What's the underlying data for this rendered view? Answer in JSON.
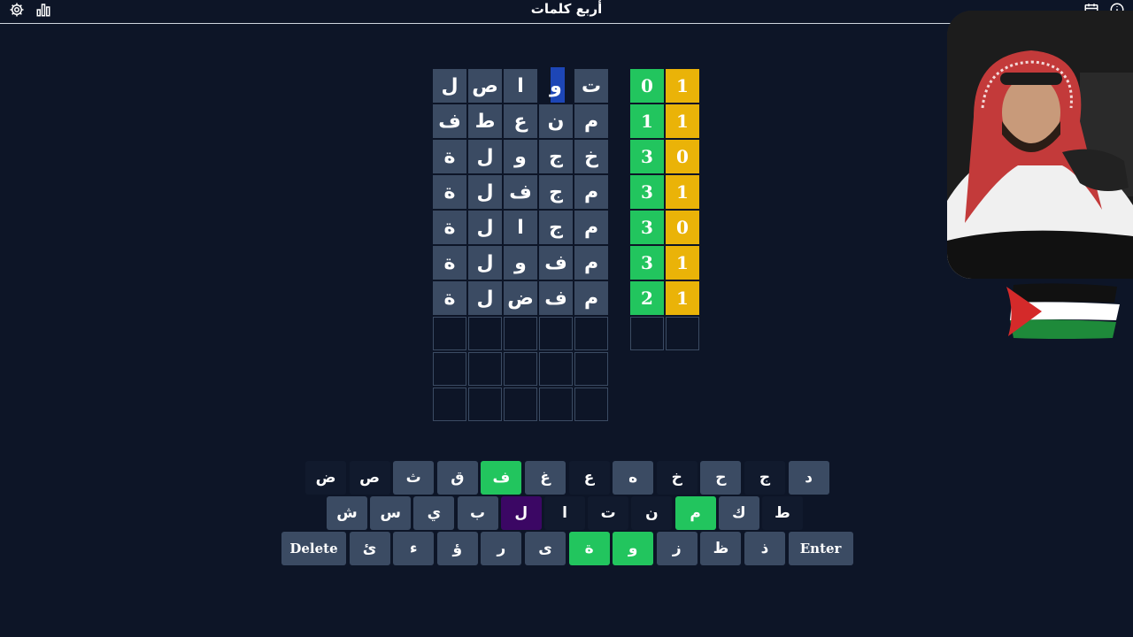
{
  "header": {
    "title": "أربع كلمات"
  },
  "icons": {
    "settings": "gear-icon",
    "stats": "bar-chart-icon",
    "calendar": "calendar-icon",
    "info": "info-icon"
  },
  "board": {
    "rows": [
      [
        "ل",
        "ص",
        "ا",
        "و",
        "ت"
      ],
      [
        "ف",
        "ط",
        "ع",
        "ن",
        "م"
      ],
      [
        "ة",
        "ل",
        "و",
        "ج",
        "خ"
      ],
      [
        "ة",
        "ل",
        "ف",
        "ج",
        "م"
      ],
      [
        "ة",
        "ل",
        "ا",
        "ج",
        "م"
      ],
      [
        "ة",
        "ل",
        "و",
        "ف",
        "م"
      ],
      [
        "ة",
        "ل",
        "ض",
        "ف",
        "م"
      ]
    ],
    "empty_rows": 3,
    "scores": [
      {
        "green": "0",
        "yellow": "1"
      },
      {
        "green": "1",
        "yellow": "1"
      },
      {
        "green": "3",
        "yellow": "0"
      },
      {
        "green": "3",
        "yellow": "1"
      },
      {
        "green": "3",
        "yellow": "0"
      },
      {
        "green": "3",
        "yellow": "1"
      },
      {
        "green": "2",
        "yellow": "1"
      }
    ],
    "colors": {
      "tile": "#3b4b63",
      "green": "#22c55e",
      "yellow": "#eab308",
      "cursor": "#1d46b6"
    }
  },
  "keyboard": {
    "row1": [
      {
        "label": "ض",
        "state": "dark"
      },
      {
        "label": "ص",
        "state": "dark"
      },
      {
        "label": "ث",
        "state": "normal"
      },
      {
        "label": "ق",
        "state": "normal"
      },
      {
        "label": "ف",
        "state": "green"
      },
      {
        "label": "غ",
        "state": "normal"
      },
      {
        "label": "ع",
        "state": "dark"
      },
      {
        "label": "ه",
        "state": "normal"
      },
      {
        "label": "خ",
        "state": "dark"
      },
      {
        "label": "ح",
        "state": "normal"
      },
      {
        "label": "ج",
        "state": "dark"
      },
      {
        "label": "د",
        "state": "normal"
      }
    ],
    "row2": [
      {
        "label": "ش",
        "state": "normal"
      },
      {
        "label": "س",
        "state": "normal"
      },
      {
        "label": "ي",
        "state": "normal"
      },
      {
        "label": "ب",
        "state": "normal"
      },
      {
        "label": "ل",
        "state": "purple"
      },
      {
        "label": "ا",
        "state": "dark"
      },
      {
        "label": "ت",
        "state": "dark"
      },
      {
        "label": "ن",
        "state": "dark"
      },
      {
        "label": "م",
        "state": "green"
      },
      {
        "label": "ك",
        "state": "normal"
      },
      {
        "label": "ط",
        "state": "dark"
      }
    ],
    "row3": [
      {
        "label": "Delete",
        "state": "normal"
      },
      {
        "label": "ئ",
        "state": "normal"
      },
      {
        "label": "ء",
        "state": "normal"
      },
      {
        "label": "ؤ",
        "state": "normal"
      },
      {
        "label": "ر",
        "state": "normal"
      },
      {
        "label": "ى",
        "state": "normal"
      },
      {
        "label": "ة",
        "state": "green"
      },
      {
        "label": "و",
        "state": "green"
      },
      {
        "label": "ز",
        "state": "normal"
      },
      {
        "label": "ظ",
        "state": "normal"
      },
      {
        "label": "ذ",
        "state": "normal"
      },
      {
        "label": "Enter",
        "state": "normal"
      }
    ]
  }
}
